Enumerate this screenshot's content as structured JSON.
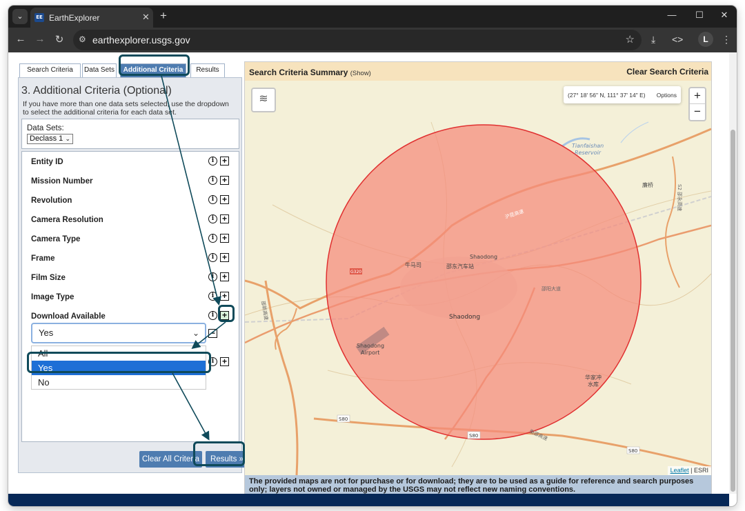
{
  "browser": {
    "tab_title": "EarthExplorer",
    "favicon_text": "EE",
    "url": "earthexplorer.usgs.gov",
    "profile_initial": "L"
  },
  "left_panel": {
    "tabs": [
      {
        "label": "Search Criteria",
        "active": false
      },
      {
        "label": "Data Sets",
        "active": false
      },
      {
        "label": "Additional Criteria",
        "active": true
      },
      {
        "label": "Results",
        "active": false
      }
    ],
    "title": "3. Additional Criteria (Optional)",
    "description": "If you have more than one data sets selected, use the dropdown to select the additional criteria for each data set.",
    "datasets_label": "Data Sets:",
    "datasets_selected": "Declass 1",
    "criteria": [
      "Entity ID",
      "Mission Number",
      "Revolution",
      "Camera Resolution",
      "Camera Type",
      "Frame",
      "Film Size",
      "Image Type",
      "Download Available"
    ],
    "download_select_value": "Yes",
    "download_options": [
      "All",
      "Yes",
      "No"
    ],
    "download_options_highlighted": "Yes",
    "clear_button": "Clear All Criteria",
    "results_button": "Results »"
  },
  "map": {
    "header_title": "Search Criteria Summary",
    "header_show": "(Show)",
    "clear_link": "Clear Search Criteria",
    "coordinates": "(27° 18' 56\" N, 111° 37' 14\" E)",
    "options_label": "Options",
    "zoom_in": "+",
    "zoom_out": "−",
    "attribution_link": "Leaflet",
    "attribution_sep": " | ",
    "attribution_text": "ESRI",
    "labels": {
      "reservoir": "Tianfaishan",
      "reservoir2": "Reservoir",
      "city_center": "Shaodong",
      "city_north": "Shaodong",
      "airport": "Shaodong",
      "airport2": "Airport",
      "niumasi": "牛马司",
      "station": "邵东汽车站",
      "hujing": "沪昆高速",
      "lianqiao": "廉桥",
      "dongda": "邵阳大道",
      "huajia": "华家冲",
      "shuiku": "水库",
      "s80a": "S80",
      "s80b": "S80",
      "s80c": "S80",
      "g320": "G320",
      "west_hwy": "邵新高速",
      "south_hwy": "衡邵高速",
      "east_vert": "S2 邵永高速"
    },
    "circle_color": "#f58b7b",
    "disclaimer": "The provided maps are not for purchase or for download; they are to be used as a guide for reference and search purposes only; layers not owned or managed by the USGS may not reflect new naming conventions."
  }
}
